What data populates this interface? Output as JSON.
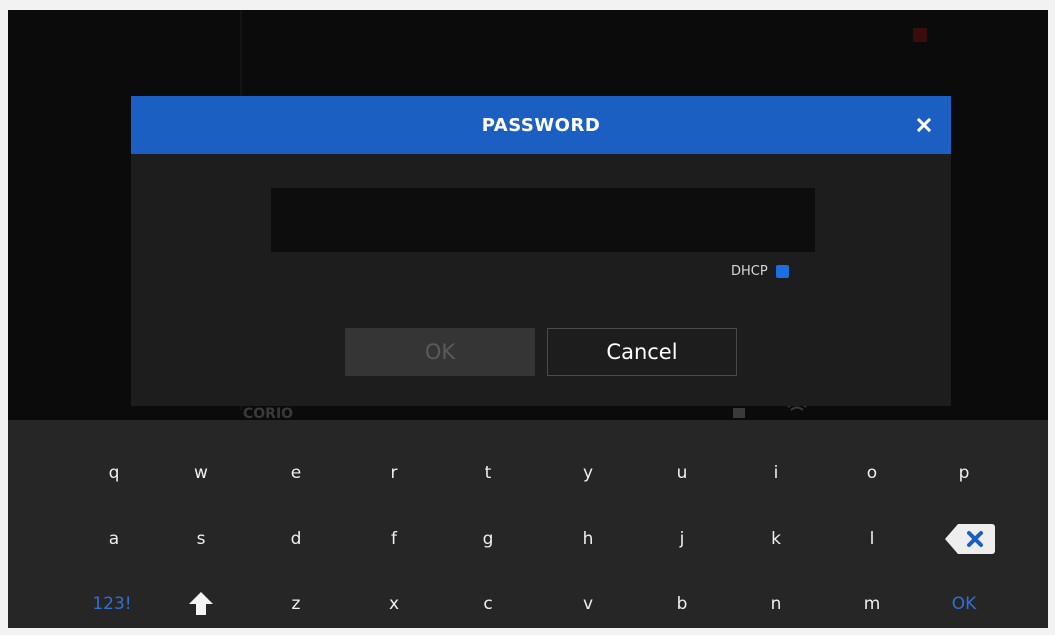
{
  "dialog": {
    "title": "PASSWORD",
    "close_icon": "close-icon",
    "password_value": "",
    "dhcp_label": "DHCP",
    "dhcp_checked": true,
    "ok_label": "OK",
    "cancel_label": "Cancel"
  },
  "background": {
    "label": "CORIO"
  },
  "keyboard": {
    "row1": [
      "q",
      "w",
      "e",
      "r",
      "t",
      "y",
      "u",
      "i",
      "o",
      "p"
    ],
    "row2": [
      "a",
      "s",
      "d",
      "f",
      "g",
      "h",
      "j",
      "k",
      "l"
    ],
    "row3": [
      "z",
      "x",
      "c",
      "v",
      "b",
      "n",
      "m"
    ],
    "mode_label": "123!",
    "ok_label": "OK",
    "shift_icon": "shift-arrow-icon",
    "backspace_icon": "backspace-icon"
  },
  "colors": {
    "header": "#1c5fc2",
    "accent": "#2f6fd6",
    "dialog_bg": "#1d1d1d",
    "keyboard_bg": "#262626"
  }
}
